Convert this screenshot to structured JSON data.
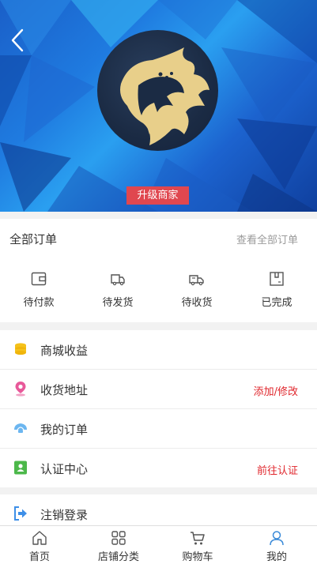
{
  "header": {
    "upgrade_label": "升级商家"
  },
  "orders": {
    "title": "全部订单",
    "view_all": "查看全部订单",
    "items": [
      {
        "label": "待付款",
        "icon": "wallet-icon"
      },
      {
        "label": "待发货",
        "icon": "truck-icon"
      },
      {
        "label": "待收货",
        "icon": "delivery-truck-icon"
      },
      {
        "label": "已完成",
        "icon": "box-icon"
      }
    ]
  },
  "menu": [
    {
      "label": "商城收益",
      "icon": "coins-icon",
      "action": ""
    },
    {
      "label": "收货地址",
      "icon": "location-pin-icon",
      "action": "添加/修改"
    },
    {
      "label": "我的订单",
      "icon": "order-shell-icon",
      "action": ""
    },
    {
      "label": "认证中心",
      "icon": "id-card-icon",
      "action": "前往认证"
    },
    {
      "label": "注销登录",
      "icon": "logout-icon",
      "action": ""
    }
  ],
  "tabbar": [
    {
      "label": "首页",
      "icon": "home-icon"
    },
    {
      "label": "店铺分类",
      "icon": "grid-icon"
    },
    {
      "label": "购物车",
      "icon": "cart-icon"
    },
    {
      "label": "我的",
      "icon": "user-icon"
    }
  ],
  "colors": {
    "accent_red": "#e0262c",
    "badge_red": "#e0474f",
    "coins_yellow": "#f5c21b",
    "pin_pink": "#e8599a",
    "shell_blue": "#6cb6f0",
    "idcard_green": "#4cb84a",
    "logout_blue": "#3d8fe8",
    "active_tab_blue": "#3a8ad8"
  }
}
